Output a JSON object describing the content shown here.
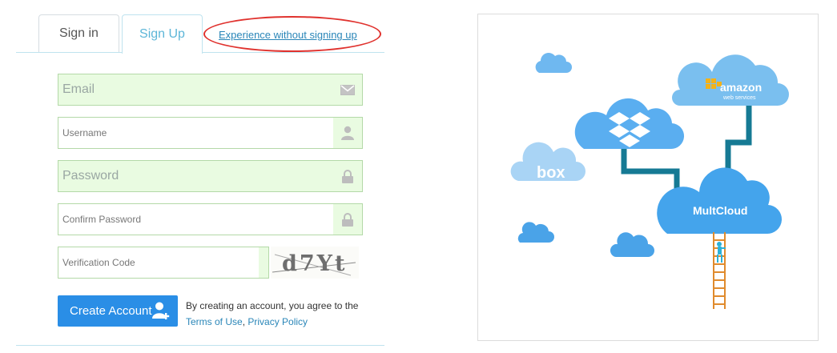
{
  "tabs": {
    "signin": "Sign in",
    "signup": "Sign Up"
  },
  "experience_link": "Experience without signing up",
  "form": {
    "email_placeholder": "Email",
    "username_placeholder": "Username",
    "password_placeholder": "Password",
    "confirm_placeholder": "Confirm Password",
    "verification_placeholder": "Verification Code",
    "captcha_text": "d7Yt"
  },
  "create_button": "Create Account",
  "agreement": {
    "prefix": "By creating an account, you agree to the",
    "terms": "Terms of Use",
    "separator": ",",
    "privacy": "Privacy Policy"
  },
  "illustration": {
    "box_label": "box",
    "amazon_label": "amazon",
    "amazon_sub": "web services",
    "multcloud_label": "MultCloud"
  },
  "colors": {
    "accent": "#2a8ee6",
    "field_bg": "#e9fbe1",
    "cloud": "#5aaef0",
    "pipe": "#167a94",
    "highlight_oval": "#e0322e"
  }
}
